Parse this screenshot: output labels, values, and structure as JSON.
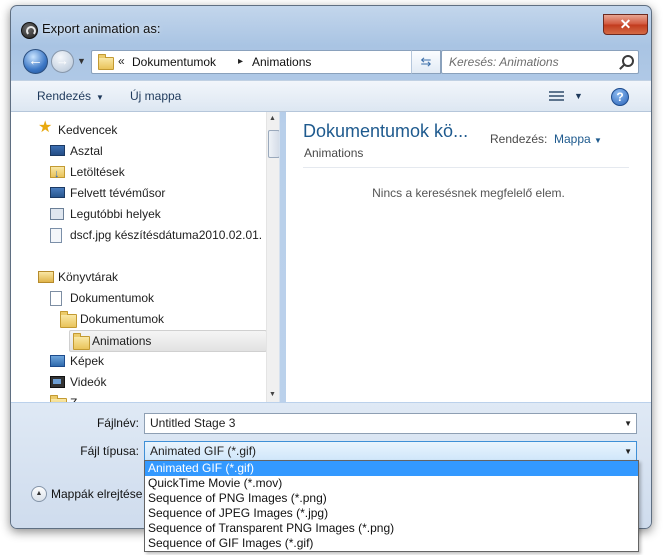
{
  "window": {
    "title": "Export animation as:",
    "close_glyph": "✕"
  },
  "nav": {
    "back_glyph": "←",
    "forward_glyph": "→",
    "breadcrumb_prefix": "«",
    "breadcrumb": [
      "Dokumentumok",
      "Animations"
    ],
    "breadcrumb_separator": "▸",
    "refresh_glyph": "⇆",
    "search_placeholder": "Keresés: Animations"
  },
  "toolbar": {
    "organize": "Rendezés",
    "new_folder": "Új mappa",
    "help_glyph": "?"
  },
  "sidebar": {
    "items": [
      {
        "label": "Kedvencek",
        "icon": "star-icon"
      },
      {
        "label": "Asztal",
        "icon": "desktop-icon"
      },
      {
        "label": "Letöltések",
        "icon": "downloads-folder-icon"
      },
      {
        "label": "Felvett tévéműsor",
        "icon": "recorded-tv-icon"
      },
      {
        "label": "Legutóbbi helyek",
        "icon": "recent-places-icon"
      },
      {
        "label": "dscf.jpg készítésdátuma2010.02.01. ...",
        "icon": "saved-search-icon"
      },
      {
        "label": "Könyvtárak",
        "icon": "libraries-icon"
      },
      {
        "label": "Dokumentumok",
        "icon": "documents-library-icon"
      },
      {
        "label": "Dokumentumok",
        "icon": "folder-icon"
      },
      {
        "label": "Animations",
        "icon": "folder-icon",
        "selected": true
      },
      {
        "label": "Képek",
        "icon": "pictures-icon"
      },
      {
        "label": "Videók",
        "icon": "videos-icon"
      },
      {
        "label": "Z",
        "icon": "folder-icon"
      }
    ]
  },
  "content": {
    "library_title": "Dokumentumok kö...",
    "library_subtitle": "Animations",
    "arrange_label": "Rendezés:",
    "arrange_value": "Mappa",
    "empty_message": "Nincs a keresésnek megfelelő elem."
  },
  "form": {
    "filename_label": "Fájlnév:",
    "filename_value": "Untitled Stage 3",
    "filetype_label": "Fájl típusa:",
    "filetype_value": "Animated GIF (*.gif)",
    "hide_folders": "Mappák elrejtése"
  },
  "dropdown": {
    "options": [
      "Animated GIF (*.gif)",
      "QuickTime Movie (*.mov)",
      "Sequence of PNG Images (*.png)",
      "Sequence of JPEG Images (*.jpg)",
      "Sequence of Transparent PNG Images (*.png)",
      "Sequence of GIF Images (*.gif)"
    ],
    "selected": 0
  }
}
